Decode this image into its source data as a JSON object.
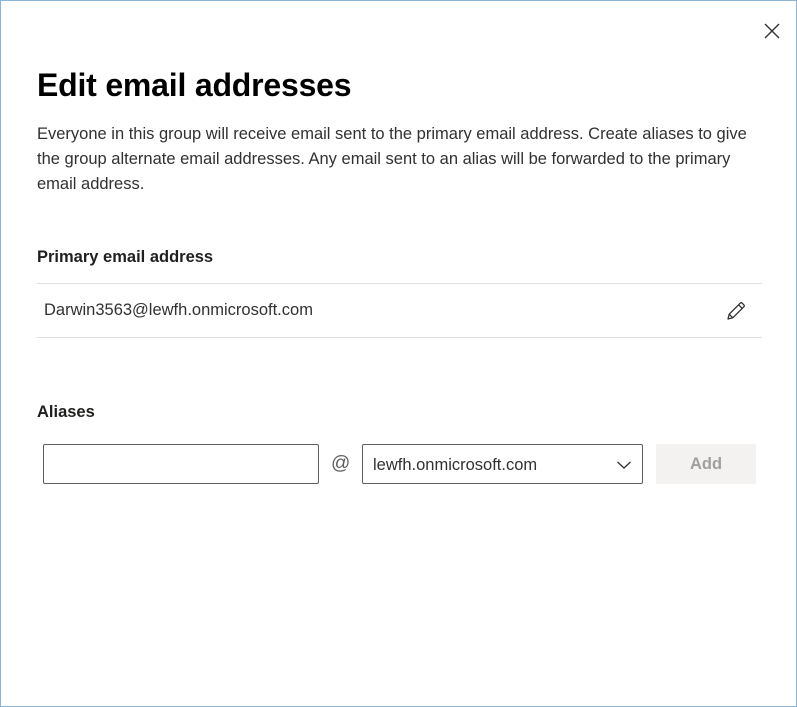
{
  "dialog": {
    "title": "Edit email addresses",
    "description": "Everyone in this group will receive email sent to the primary email address. Create aliases to give the group alternate email addresses. Any email sent to an alias will be forwarded to the primary email address."
  },
  "primary": {
    "label": "Primary email address",
    "email": "Darwin3563@lewfh.onmicrosoft.com"
  },
  "aliases": {
    "label": "Aliases",
    "input_value": "",
    "input_placeholder": "",
    "at_symbol": "@",
    "domain_selected": "lewfh.onmicrosoft.com",
    "add_label": "Add"
  },
  "icons": {
    "close": "close-icon",
    "edit": "pencil-icon",
    "dropdown": "chevron-down-icon"
  },
  "colors": {
    "border_accent": "#8ab4d8",
    "disabled_button_bg": "#f3f2f1",
    "disabled_button_text": "#a19f9d"
  }
}
